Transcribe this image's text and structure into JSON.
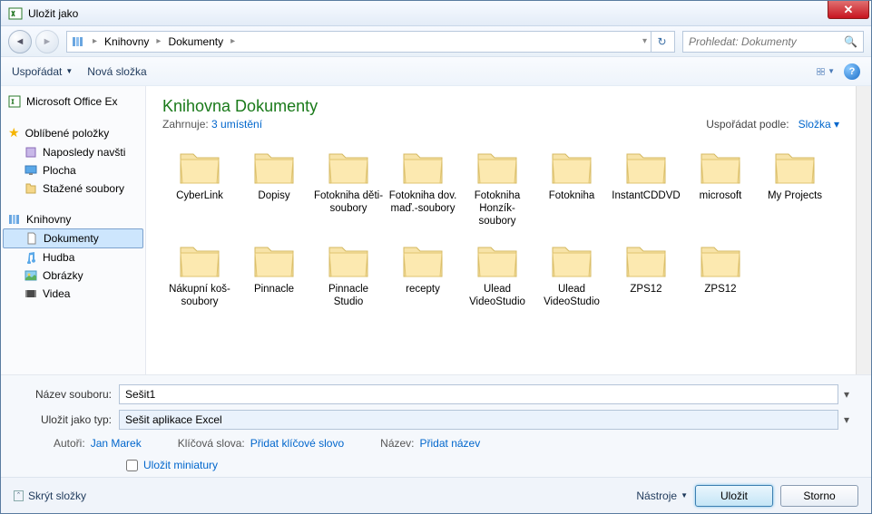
{
  "title": "Uložit jako",
  "breadcrumb": {
    "items": [
      "Knihovny",
      "Dokumenty"
    ]
  },
  "search": {
    "placeholder": "Prohledat: Dokumenty"
  },
  "toolbar": {
    "organize": "Uspořádat",
    "newfolder": "Nová složka"
  },
  "sidebar": {
    "top": "Microsoft Office Ex",
    "favorites": {
      "label": "Oblíbené položky",
      "items": [
        "Naposledy navšti",
        "Plocha",
        "Stažené soubory"
      ]
    },
    "libraries": {
      "label": "Knihovny",
      "items": [
        "Dokumenty",
        "Hudba",
        "Obrázky",
        "Videa"
      ],
      "selected": 0
    }
  },
  "content": {
    "title": "Knihovna Dokumenty",
    "subtitle_prefix": "Zahrnuje: ",
    "subtitle_link": "3 umístění",
    "arrange_label": "Uspořádat podle:",
    "arrange_value": "Složka",
    "folders": [
      "CyberLink",
      "Dopisy",
      "Fotokniha děti-soubory",
      "Fotokniha dov. maď.-soubory",
      "Fotokniha Honzík-soubory",
      "Fotokniha",
      "InstantCDDVD",
      "microsoft",
      "My Projects",
      "Nákupní koš-soubory",
      "Pinnacle",
      "Pinnacle Studio",
      "recepty",
      "Ulead VideoStudio",
      "Ulead VideoStudio",
      "ZPS12",
      "ZPS12"
    ]
  },
  "form": {
    "filename_label": "Název souboru:",
    "filename_value": "Sešit1",
    "filetype_label": "Uložit jako typ:",
    "filetype_value": "Sešit aplikace Excel",
    "meta": {
      "authors_label": "Autoři:",
      "authors_value": "Jan Marek",
      "keywords_label": "Klíčová slova:",
      "keywords_value": "Přidat klíčové slovo",
      "title_label": "Název:",
      "title_value": "Přidat název"
    },
    "thumbnails": "Uložit miniatury"
  },
  "footer": {
    "hide": "Skrýt složky",
    "tools": "Nástroje",
    "save": "Uložit",
    "cancel": "Storno"
  }
}
